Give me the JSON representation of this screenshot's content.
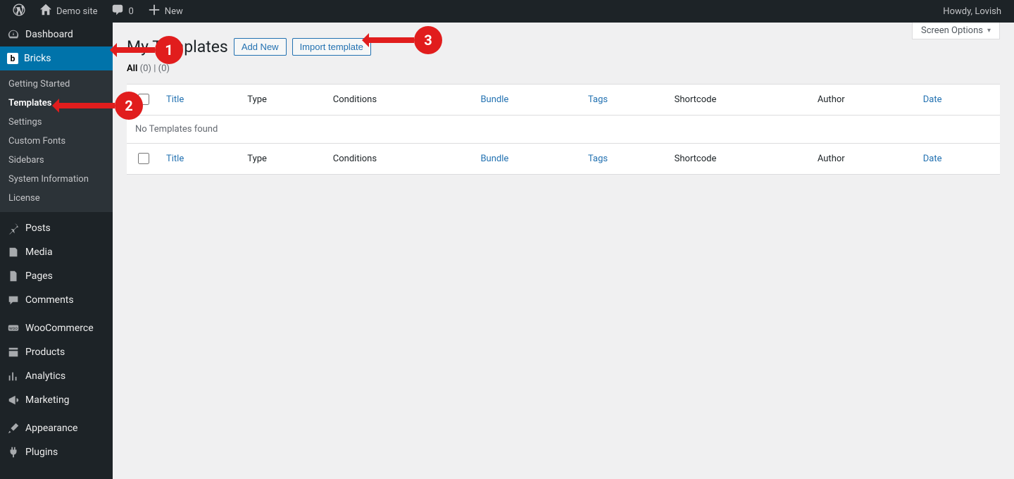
{
  "adminbar": {
    "site_name": "Demo site",
    "comments_count": "0",
    "new_label": "New",
    "howdy": "Howdy, Lovish"
  },
  "sidebar": {
    "dashboard": "Dashboard",
    "bricks": "Bricks",
    "bricks_sub": {
      "getting_started": "Getting Started",
      "templates": "Templates",
      "settings": "Settings",
      "custom_fonts": "Custom Fonts",
      "sidebars": "Sidebars",
      "system_info": "System Information",
      "license": "License"
    },
    "posts": "Posts",
    "media": "Media",
    "pages": "Pages",
    "comments": "Comments",
    "woocommerce": "WooCommerce",
    "products": "Products",
    "analytics": "Analytics",
    "marketing": "Marketing",
    "appearance": "Appearance",
    "plugins": "Plugins"
  },
  "page": {
    "title": "My Templates",
    "add_new": "Add New",
    "import": "Import template",
    "screen_options": "Screen Options"
  },
  "filters": {
    "all_label": "All",
    "all_count": "(0)",
    "separator": "|",
    "trash_count": "(0)"
  },
  "table": {
    "columns": {
      "title": "Title",
      "type": "Type",
      "conditions": "Conditions",
      "bundle": "Bundle",
      "tags": "Tags",
      "shortcode": "Shortcode",
      "author": "Author",
      "date": "Date"
    },
    "no_items": "No Templates found"
  },
  "annotations": {
    "s1": "1",
    "s2": "2",
    "s3": "3"
  }
}
